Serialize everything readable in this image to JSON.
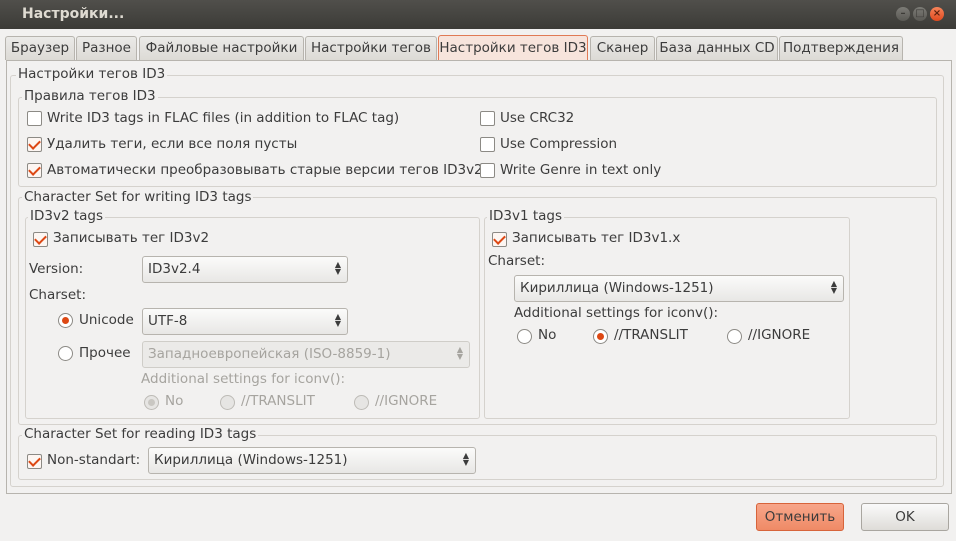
{
  "window": {
    "title": "Настройки..."
  },
  "tabs": [
    {
      "label": "Браузер",
      "active": false
    },
    {
      "label": "Разное",
      "active": false
    },
    {
      "label": "Файловые настройки",
      "active": false
    },
    {
      "label": "Настройки тегов",
      "active": false
    },
    {
      "label": "Настройки тегов ID3",
      "active": true
    },
    {
      "label": "Сканер",
      "active": false
    },
    {
      "label": "База данных CD",
      "active": false
    },
    {
      "label": "Подтверждения",
      "active": false
    }
  ],
  "panel": {
    "title": "Настройки тегов ID3",
    "rules": {
      "title": "Правила тегов ID3",
      "write_flac": {
        "label": "Write ID3 tags in FLAC files (in addition to FLAC tag)",
        "checked": false
      },
      "remove_empty": {
        "label": "Удалить теги, если все поля пусты",
        "checked": true
      },
      "auto_convert": {
        "label": "Автоматически преобразовывать старые версии тегов ID3v2",
        "checked": true
      },
      "use_crc32": {
        "label": "Use CRC32",
        "checked": false
      },
      "use_compression": {
        "label": "Use Compression",
        "checked": false
      },
      "genre_text": {
        "label": "Write Genre in text only",
        "checked": false
      }
    },
    "writing": {
      "title": "Character Set for writing ID3 tags",
      "id3v2": {
        "title": "ID3v2 tags",
        "write_tag": {
          "label": "Записывать тег ID3v2",
          "checked": true
        },
        "version_label": "Version:",
        "version_value": "ID3v2.4",
        "charset_label": "Charset:",
        "unicode_label": "Unicode",
        "unicode_value": "UTF-8",
        "other_label": "Прочее",
        "other_value": "Западноевропейская (ISO-8859-1)",
        "iconv_label": "Additional settings for iconv():",
        "opt_no": "No",
        "opt_translit": "//TRANSLIT",
        "opt_ignore": "//IGNORE",
        "selected_charset": "Unicode",
        "selected_iconv": "No"
      },
      "id3v1": {
        "title": "ID3v1 tags",
        "write_tag": {
          "label": "Записывать тег ID3v1.x",
          "checked": true
        },
        "charset_label": "Charset:",
        "charset_value": "Кириллица (Windows-1251)",
        "iconv_label": "Additional settings for iconv():",
        "opt_no": "No",
        "opt_translit": "//TRANSLIT",
        "opt_ignore": "//IGNORE",
        "selected_iconv": "//TRANSLIT"
      }
    },
    "reading": {
      "title": "Character Set for reading ID3 tags",
      "nonstandard": {
        "label": "Non-standart:",
        "checked": true
      },
      "charset_value": "Кириллица (Windows-1251)"
    }
  },
  "buttons": {
    "cancel": "Отменить",
    "ok": "OK"
  },
  "colors": {
    "accent": "#dd4814",
    "titlebar": "#3c3b37",
    "window_bg": "#f2f1f0",
    "active_tab": "#f7e4dc"
  }
}
